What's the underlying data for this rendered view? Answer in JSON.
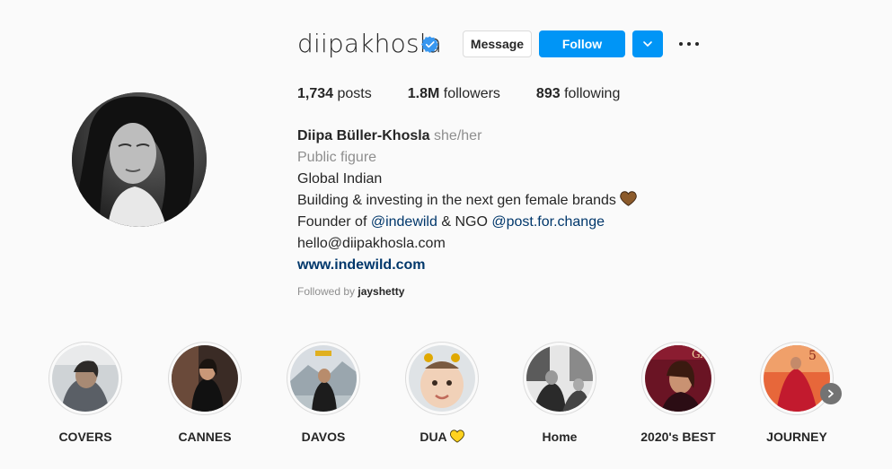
{
  "profile": {
    "username": "diipakhosla",
    "verified": true,
    "buttons": {
      "message": "Message",
      "follow": "Follow"
    },
    "stats": [
      {
        "value": "1,734",
        "label": "posts"
      },
      {
        "value": "1.8M",
        "label": "followers"
      },
      {
        "value": "893",
        "label": "following"
      }
    ],
    "bio": {
      "full_name": "Diipa Büller-Khosla",
      "pronouns": "she/her",
      "category": "Public figure",
      "line1": "Global Indian",
      "line2": "Building & investing in the next gen female brands",
      "line3_prefix": "Founder of ",
      "mention1": "@indewild",
      "line3_middle": " & NGO ",
      "mention2": "@post.for.change",
      "email": "hello@diipakhosla.com",
      "website": "www.indewild.com"
    },
    "followed_by": {
      "prefix": "Followed by ",
      "user": "jayshetty"
    }
  },
  "highlights": [
    {
      "label": "COVERS"
    },
    {
      "label": "CANNES"
    },
    {
      "label": "DAVOS"
    },
    {
      "label": "DUA"
    },
    {
      "label": "Home"
    },
    {
      "label": "2020's BEST"
    },
    {
      "label": "JOURNEY"
    }
  ],
  "colors": {
    "accent": "#0095f6",
    "link": "#00376b",
    "muted": "#8e8e8e",
    "verified": "#3897f0"
  },
  "icons": {
    "verified": "verified-badge-icon",
    "dropdown": "chevron-down-icon",
    "more": "more-options-icon",
    "heart": "brown-heart-icon",
    "next": "chevron-right-icon"
  }
}
